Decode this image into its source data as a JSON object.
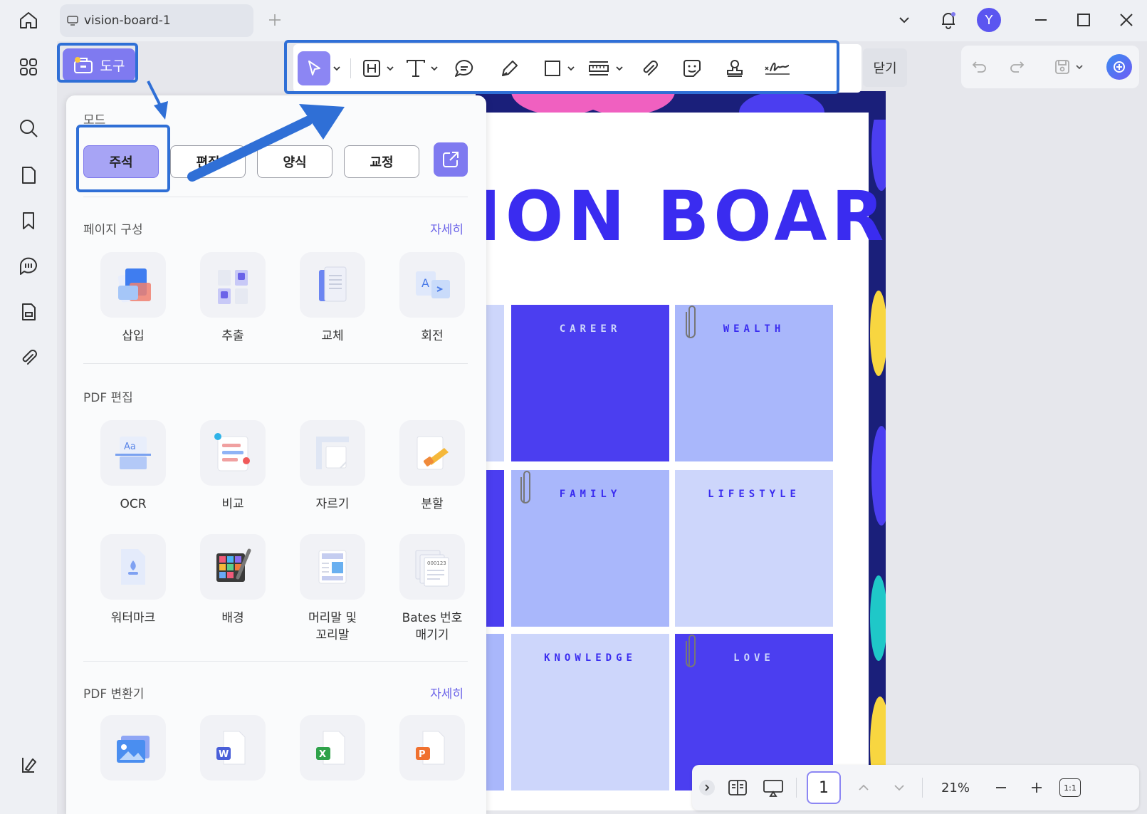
{
  "titlebar": {
    "tab_title": "vision-board-1",
    "avatar_letter": "Y"
  },
  "toolbar": {
    "tools_label": "도구",
    "close_label": "닫기"
  },
  "panel": {
    "mode_title": "모드",
    "modes": [
      "주석",
      "편집",
      "양식",
      "교정"
    ],
    "page_section": {
      "title": "페이지 구성",
      "more": "자세히",
      "items": [
        "삽입",
        "추출",
        "교체",
        "회전"
      ]
    },
    "edit_section": {
      "title": "PDF 편집",
      "items": [
        "OCR",
        "비교",
        "자르기",
        "분할",
        "워터마크",
        "배경",
        "머리말 및\n꼬리말",
        "Bates 번호\n매기기"
      ]
    },
    "convert_section": {
      "title": "PDF 변환기",
      "more": "자세히"
    }
  },
  "document": {
    "title_visible": "ION BOARD",
    "tiles": [
      "CAREER",
      "WEALTH",
      "FAMILY",
      "LIFESTYLE",
      "KNOWLEDGE",
      "LOVE"
    ],
    "colors": {
      "dark_blue": "#4b3ef0",
      "mid_blue": "#a9b7fb",
      "light_blue": "#cdd6fb",
      "title": "#3a2cf0"
    }
  },
  "bottombar": {
    "page_number": "1",
    "zoom": "21%",
    "fit_label": "1:1"
  },
  "colors": {
    "accent": "#7f7af0",
    "highlight": "#2f6fd6"
  }
}
